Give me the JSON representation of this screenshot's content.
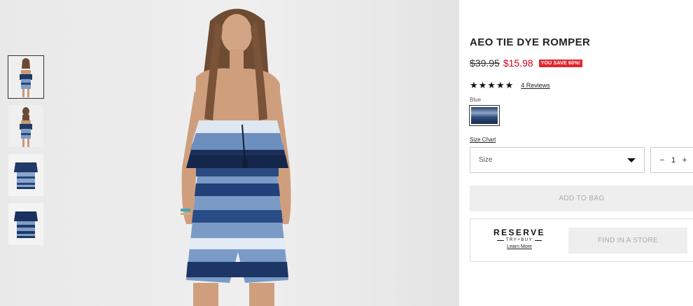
{
  "product": {
    "title": "AEO TIE DYE ROMPER",
    "original_price": "$39.95",
    "sale_price": "$15.98",
    "savings_badge": "YOU SAVE 60%!",
    "stars": "★★★★★",
    "reviews_link": "4 Reviews",
    "color_label": "Blue",
    "size_chart_link": "Size Chart",
    "size_placeholder": "Size",
    "quantity": "1",
    "qty_minus": "−",
    "qty_plus": "+",
    "add_to_bag": "ADD TO BAG"
  },
  "reserve": {
    "logo_word": "RESERVE",
    "logo_sub": "TRY+BUY",
    "learn_more": "Learn More",
    "find_store": "FIND IN A STORE"
  },
  "colors": {
    "sale_red": "#d0021b",
    "badge_red": "#e1262d",
    "disabled_button_bg": "#eeeeee"
  },
  "gallery": {
    "thumbnails": [
      "front",
      "back",
      "flat-front",
      "flat-back"
    ]
  }
}
